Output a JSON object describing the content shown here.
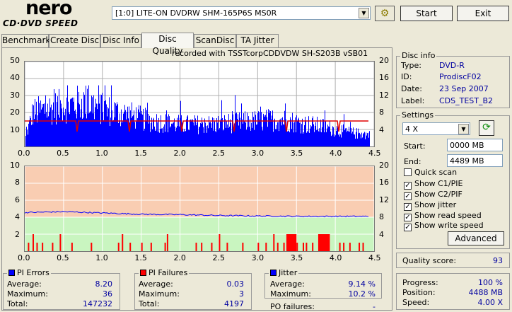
{
  "logo": {
    "brand": "nero",
    "product": "CD·DVD SPEED"
  },
  "drive": {
    "selected": "[1:0]  LITE-ON DVDRW SHM-165P6S MS0R"
  },
  "buttons": {
    "start": "Start",
    "exit": "Exit",
    "advanced": "Advanced"
  },
  "tabs": [
    {
      "label": "Benchmark"
    },
    {
      "label": "Create Disc"
    },
    {
      "label": "Disc Info"
    },
    {
      "label": "Disc Quality",
      "active": true
    },
    {
      "label": "ScanDisc"
    },
    {
      "label": "TA Jitter"
    }
  ],
  "chart_data": [
    {
      "type": "bar",
      "title": "recorded with TSSTcorpCDDVDW SH-S203B  vSB01",
      "x_ticks": [
        "0.0",
        "0.5",
        "1.0",
        "1.5",
        "2.0",
        "2.5",
        "3.0",
        "3.5",
        "4.0",
        "4.5"
      ],
      "y_left_ticks": [
        "50",
        "40",
        "30",
        "20",
        "10"
      ],
      "y_right_ticks": [
        "20",
        "16",
        "12",
        "8",
        "4"
      ],
      "xlim": [
        0,
        4.5
      ],
      "ylim": [
        0,
        50
      ],
      "y2lim": [
        0,
        20
      ],
      "series": [
        {
          "type": "bar",
          "color": "#0000ff",
          "profile": [
            [
              0,
              4
            ],
            [
              0.05,
              12
            ],
            [
              0.1,
              20
            ],
            [
              0.3,
              22
            ],
            [
              0.5,
              24
            ],
            [
              0.8,
              26
            ],
            [
              1.0,
              22
            ],
            [
              1.2,
              20
            ],
            [
              1.4,
              18
            ],
            [
              1.6,
              15
            ],
            [
              2.0,
              13
            ],
            [
              2.4,
              13
            ],
            [
              2.7,
              14
            ],
            [
              3.0,
              15
            ],
            [
              3.3,
              16
            ],
            [
              3.5,
              14
            ],
            [
              3.8,
              12
            ],
            [
              4.0,
              10
            ],
            [
              4.2,
              8
            ],
            [
              4.4,
              7
            ]
          ]
        },
        {
          "type": "line",
          "color": "#e00000",
          "values": [
            [
              0,
              6
            ],
            [
              4.44,
              6
            ]
          ]
        }
      ]
    },
    {
      "type": "bar",
      "x_ticks": [
        "0.0",
        "0.5",
        "1.0",
        "1.5",
        "2.0",
        "2.5",
        "3.0",
        "3.5",
        "4.0",
        "4.5"
      ],
      "y_left_ticks": [
        "10",
        "8",
        "6",
        "4",
        "2"
      ],
      "y_right_ticks": [
        "20",
        "16",
        "12",
        "8",
        "4"
      ],
      "xlim": [
        0,
        4.5
      ],
      "ylim": [
        0,
        10
      ],
      "y2lim": [
        0,
        20
      ],
      "series": [
        {
          "type": "bar",
          "color": "#ff0000",
          "values": [
            [
              0.04,
              1
            ],
            [
              0.1,
              2
            ],
            [
              0.15,
              1
            ],
            [
              0.22,
              1
            ],
            [
              0.35,
              1
            ],
            [
              0.45,
              2
            ],
            [
              0.6,
              1
            ],
            [
              0.85,
              1
            ],
            [
              1.2,
              1
            ],
            [
              1.25,
              2
            ],
            [
              1.35,
              1
            ],
            [
              1.5,
              1
            ],
            [
              1.62,
              1
            ],
            [
              1.8,
              1
            ],
            [
              1.83,
              2
            ],
            [
              2.2,
              1
            ],
            [
              2.27,
              1
            ],
            [
              2.4,
              1
            ],
            [
              2.5,
              2
            ],
            [
              2.6,
              1
            ],
            [
              2.8,
              1
            ],
            [
              3.0,
              1
            ],
            [
              3.1,
              1
            ],
            [
              3.2,
              2
            ],
            [
              3.25,
              1
            ],
            [
              3.33,
              1
            ],
            [
              3.45,
              1
            ],
            [
              3.5,
              1
            ],
            [
              3.58,
              1
            ],
            [
              3.62,
              1
            ],
            [
              3.7,
              1
            ],
            [
              3.9,
              1
            ],
            [
              4.05,
              1
            ],
            [
              4.1,
              1
            ],
            [
              4.18,
              1
            ],
            [
              4.3,
              1
            ],
            [
              4.35,
              1
            ]
          ],
          "blocks": [
            [
              3.37,
              3.5,
              2
            ],
            [
              3.78,
              3.93,
              2
            ]
          ]
        },
        {
          "type": "line",
          "color": "#0000ff",
          "name": "jitter",
          "values": [
            [
              0,
              9.1
            ],
            [
              0.5,
              9.3
            ],
            [
              1.0,
              9.0
            ],
            [
              1.5,
              8.7
            ],
            [
              2.0,
              8.6
            ],
            [
              2.5,
              8.4
            ],
            [
              3.0,
              8.3
            ],
            [
              3.5,
              8.2
            ],
            [
              4.0,
              8.2
            ],
            [
              4.44,
              8.2
            ]
          ]
        }
      ]
    }
  ],
  "stats": {
    "pi_errors": {
      "title": "PI Errors",
      "color": "#0000ff",
      "average_label": "Average:",
      "average": "8.20",
      "maximum_label": "Maximum:",
      "maximum": "36",
      "total_label": "Total:",
      "total": "147232"
    },
    "pi_failures": {
      "title": "PI Failures",
      "color": "#ff0000",
      "average_label": "Average:",
      "average": "0.03",
      "maximum_label": "Maximum:",
      "maximum": "3",
      "total_label": "Total:",
      "total": "4197"
    },
    "jitter": {
      "title": "Jitter",
      "color": "#0000ff",
      "average_label": "Average:",
      "average": "9.14 %",
      "maximum_label": "Maximum:",
      "maximum": "10.2 %"
    },
    "po_failures_label": "PO failures:",
    "po_failures": "-"
  },
  "disc_info": {
    "title": "Disc info",
    "rows": [
      {
        "label": "Type:",
        "value": "DVD-R"
      },
      {
        "label": "ID:",
        "value": "ProdiscF02"
      },
      {
        "label": "Date:",
        "value": "23 Sep 2007"
      },
      {
        "label": "Label:",
        "value": "CDS_TEST_B2"
      }
    ]
  },
  "settings": {
    "title": "Settings",
    "speed": "4 X",
    "start_label": "Start:",
    "start": "0000 MB",
    "end_label": "End:",
    "end": "4489 MB",
    "checkboxes": [
      {
        "label": "Quick scan",
        "checked": false
      },
      {
        "label": "Show C1/PIE",
        "checked": true
      },
      {
        "label": "Show C2/PIF",
        "checked": true
      },
      {
        "label": "Show jitter",
        "checked": true
      },
      {
        "label": "Show read speed",
        "checked": true
      },
      {
        "label": "Show write speed",
        "checked": true
      }
    ]
  },
  "quality": {
    "label": "Quality score:",
    "value": "93"
  },
  "progress": {
    "progress_label": "Progress:",
    "progress": "100 %",
    "position_label": "Position:",
    "position": "4488 MB",
    "speed_label": "Speed:",
    "speed": "4.00 X"
  },
  "icons": {
    "refresh": "refresh-icon",
    "drive_info": "drive-info-icon",
    "dropdown": "chevron-down-icon"
  }
}
